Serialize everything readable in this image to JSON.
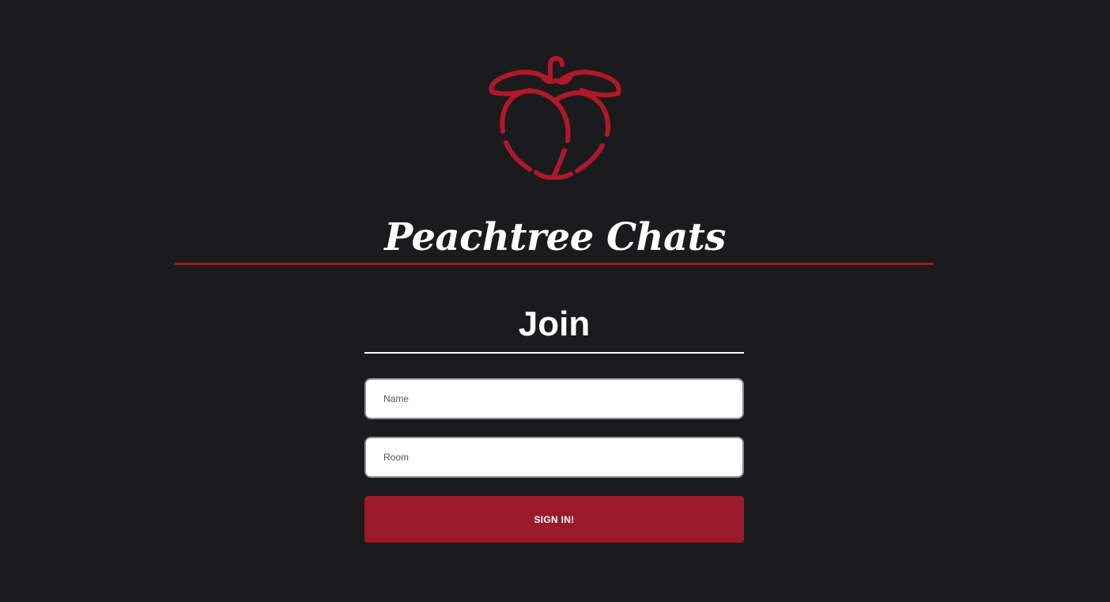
{
  "brand": {
    "logo_icon": "peach-icon",
    "logo_color": "#b0182b",
    "title": "Peachtree Chats",
    "accent_color": "#9b1a29"
  },
  "form": {
    "heading": "Join",
    "name_placeholder": "Name",
    "name_value": "",
    "room_placeholder": "Room",
    "room_value": "",
    "submit_label": "SIGN IN!"
  },
  "colors": {
    "background": "#1b1b1d",
    "text": "#ffffff",
    "button": "#9b1a29"
  }
}
